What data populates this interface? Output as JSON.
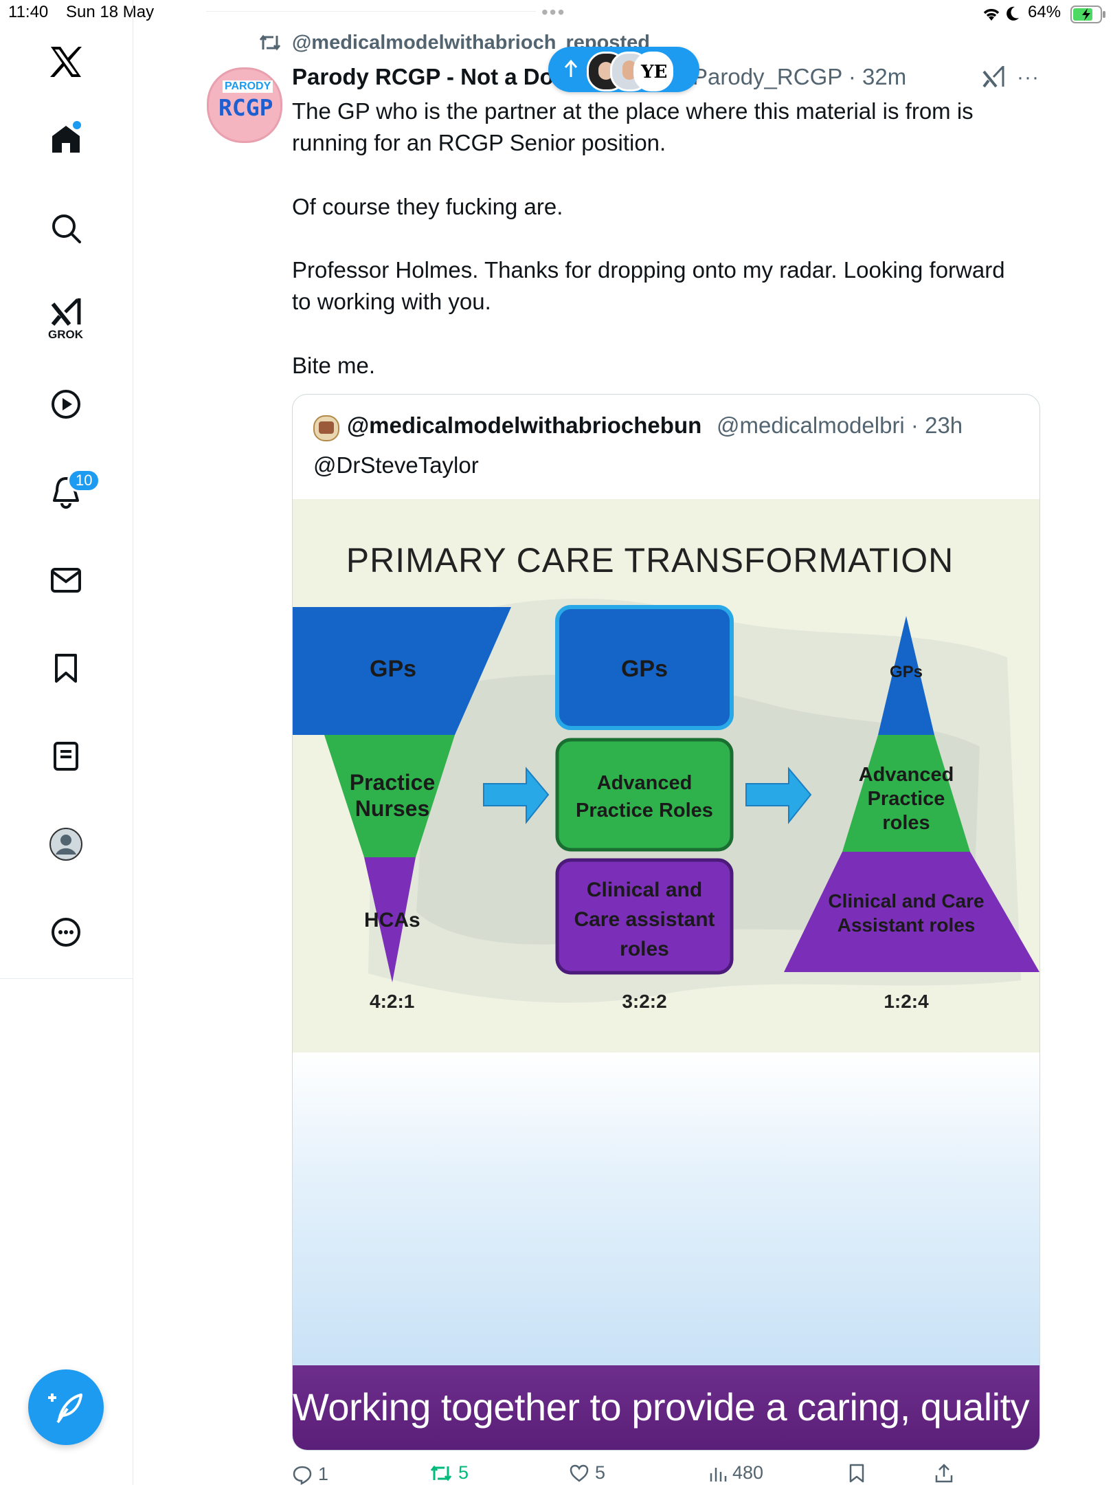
{
  "status_bar": {
    "time": "11:40",
    "date": "Sun 18 May",
    "battery": "64%"
  },
  "sidebar": {
    "items": [
      {
        "name": "x-logo-icon"
      },
      {
        "name": "home-icon"
      },
      {
        "name": "search-icon"
      },
      {
        "name": "grok-icon",
        "label": "GROK"
      },
      {
        "name": "video-icon"
      },
      {
        "name": "notifications-icon",
        "badge": "10"
      },
      {
        "name": "messages-icon"
      },
      {
        "name": "bookmarks-icon"
      },
      {
        "name": "lists-icon"
      },
      {
        "name": "profile-icon"
      },
      {
        "name": "more-icon"
      }
    ],
    "accent": "#1d9bf0"
  },
  "tweet": {
    "reposted_by": "@medicalmodelwithabrioch",
    "reposted_suffix": "reposted",
    "avatar_top": "PARODY",
    "avatar_bottom": "RCGP",
    "display_name": "Parody RCGP - Not a Do",
    "handle_time": "Parody_RCGP · 32m",
    "text_1": "The GP who is the partner at the place where this material is from is\nrunning for an RCGP Senior position.",
    "text_2": "Of course they fucking are.",
    "text_3": "Professor Holmes. Thanks for dropping onto my radar. Looking forward\nto working with you.",
    "text_4": "Bite me.",
    "new_posts_pill": "YE"
  },
  "quote": {
    "display_name": "@medicalmodelwithabriochebun",
    "handle_time": "@medicalmodelbri · 23h",
    "text": "@DrSteveTaylor",
    "image": {
      "title": "PRIMARY CARE TRANSFORMATION",
      "left": {
        "top": "GPs",
        "middle": "Practice\nNurses",
        "bottom": "HCAs",
        "ratio": "4:2:1"
      },
      "center": {
        "top": "GPs",
        "middle": "Advanced\nPractice Roles",
        "bottom": "Clinical and\nCare assistant\nroles",
        "ratio": "3:2:2"
      },
      "right": {
        "top": "GPs",
        "middle": "Advanced\nPractice\nroles",
        "bottom": "Clinical and Care\nAssistant roles",
        "ratio": "1:2:4"
      },
      "banner": "Working together to provide a caring, quality serv",
      "colors": {
        "blue": "#1565c8",
        "green": "#2fb24c",
        "purple": "#7b2fb8",
        "arrow": "#29a8e8"
      }
    }
  },
  "actions": {
    "replies": "1",
    "reposts": "5",
    "likes": "5",
    "views": "480"
  }
}
